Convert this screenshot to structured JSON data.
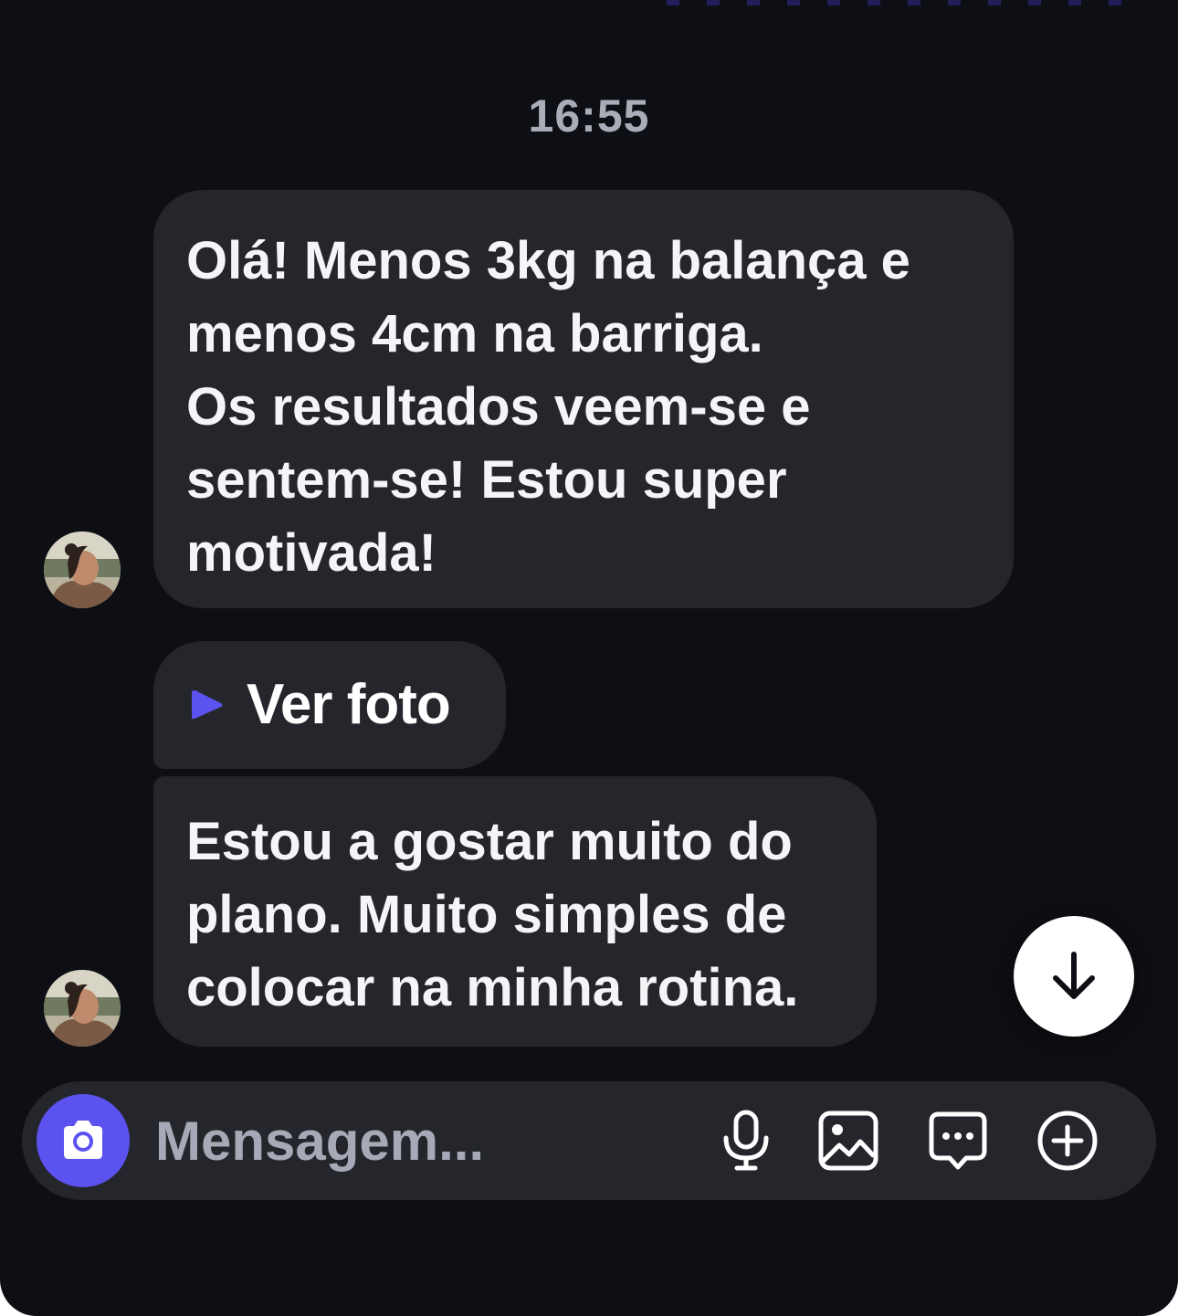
{
  "chat": {
    "timestamp": "16:55",
    "messages": [
      {
        "lines": [
          "Olá! Menos 3kg na balança e",
          "menos 4cm na barriga.",
          "Os resultados veem-se e",
          "sentem-se! Estou super",
          "motivada!"
        ]
      },
      {
        "media_label": "Ver foto",
        "icon": "play-icon"
      },
      {
        "lines": [
          "Estou a gostar muito do",
          "plano. Muito simples de",
          "colocar na minha rotina."
        ]
      }
    ]
  },
  "composer": {
    "placeholder": "Mensagem...",
    "icons": [
      "camera-icon",
      "microphone-icon",
      "gallery-icon",
      "sticker-icon",
      "plus-icon"
    ]
  },
  "scroll_button": {
    "icon": "arrow-down-icon"
  },
  "colors": {
    "background": "#0d0f14",
    "bubble": "#24262c",
    "accent": "#5b52f0",
    "text": "#f4f5f7",
    "muted_text": "#a9adb8"
  }
}
